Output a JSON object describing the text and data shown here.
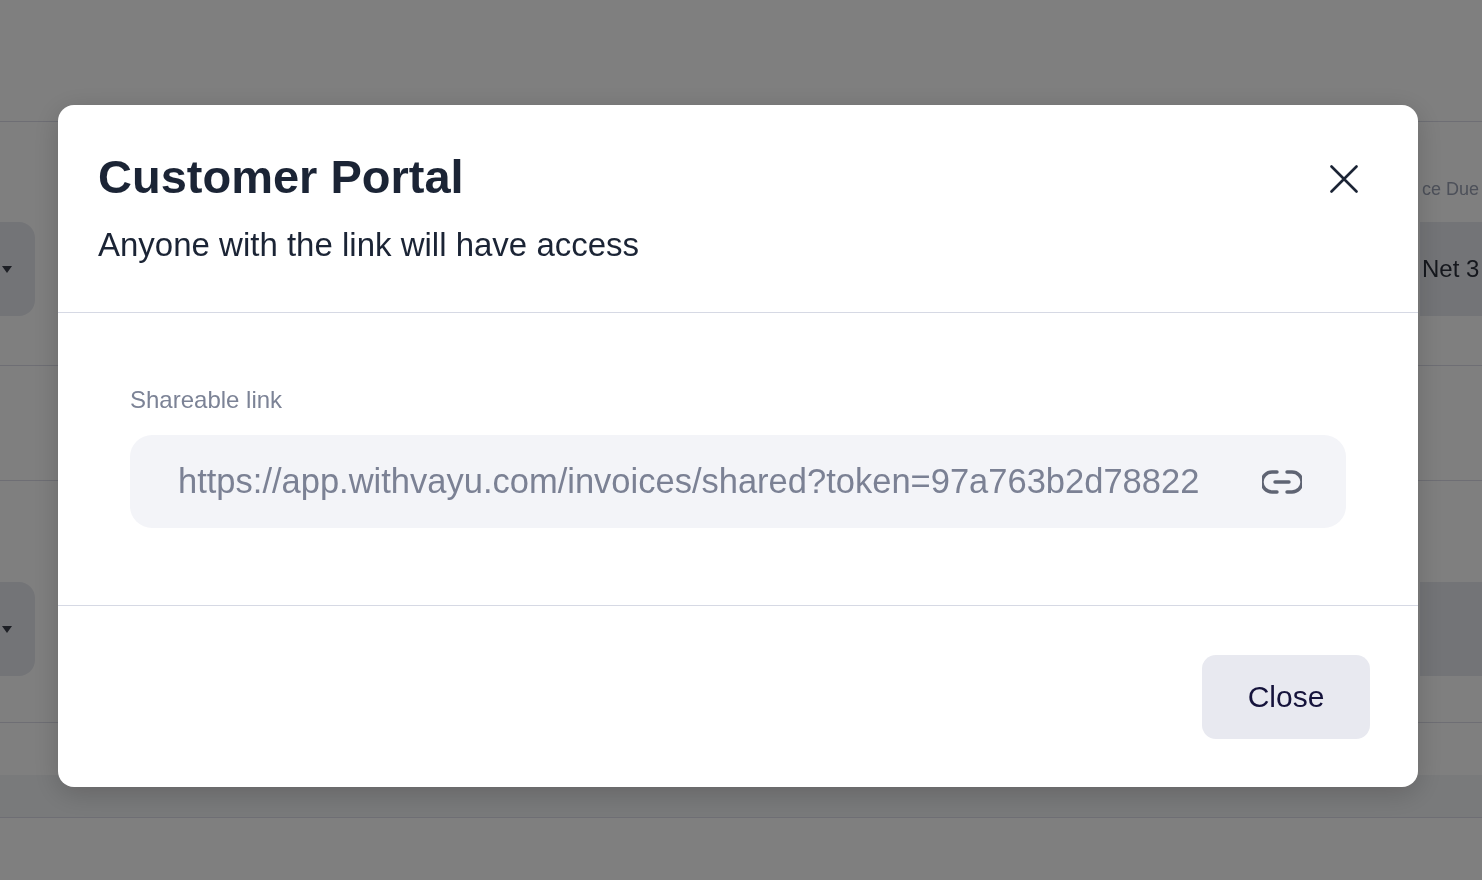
{
  "background": {
    "column_header": "ce Due",
    "field_values": [
      "Net 3"
    ]
  },
  "dialog": {
    "title": "Customer Portal",
    "subtitle": "Anyone with the link will have access",
    "field": {
      "label": "Shareable link",
      "value": "https://app.withvayu.com/invoices/shared?token=97a763b2d78822"
    },
    "buttons": [
      {
        "label": "Close"
      }
    ]
  }
}
